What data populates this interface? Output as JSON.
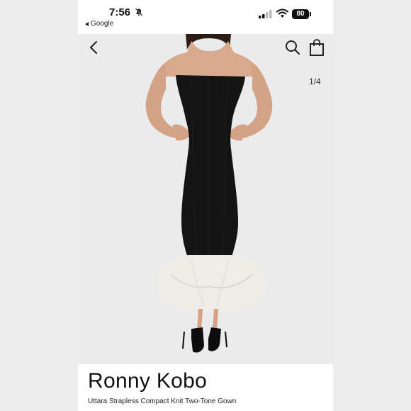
{
  "status_bar": {
    "time": "7:56",
    "back_app_label": "Google",
    "battery_level": "80",
    "icons": [
      "bell-slash-icon",
      "signal-icon",
      "wifi-icon",
      "battery-icon"
    ]
  },
  "product_header": {
    "icons": [
      "back-arrow-icon",
      "search-icon",
      "shopping-bag-icon"
    ]
  },
  "gallery": {
    "pager": "1/4"
  },
  "product": {
    "brand": "Ronny Kobo",
    "name": "Uttara Strapless Compact Knit Two-Tone Gown"
  },
  "colors": {
    "background": "#ebebeb",
    "dress_black": "#141414",
    "ruffle_white": "#efece6",
    "text": "#111111"
  }
}
